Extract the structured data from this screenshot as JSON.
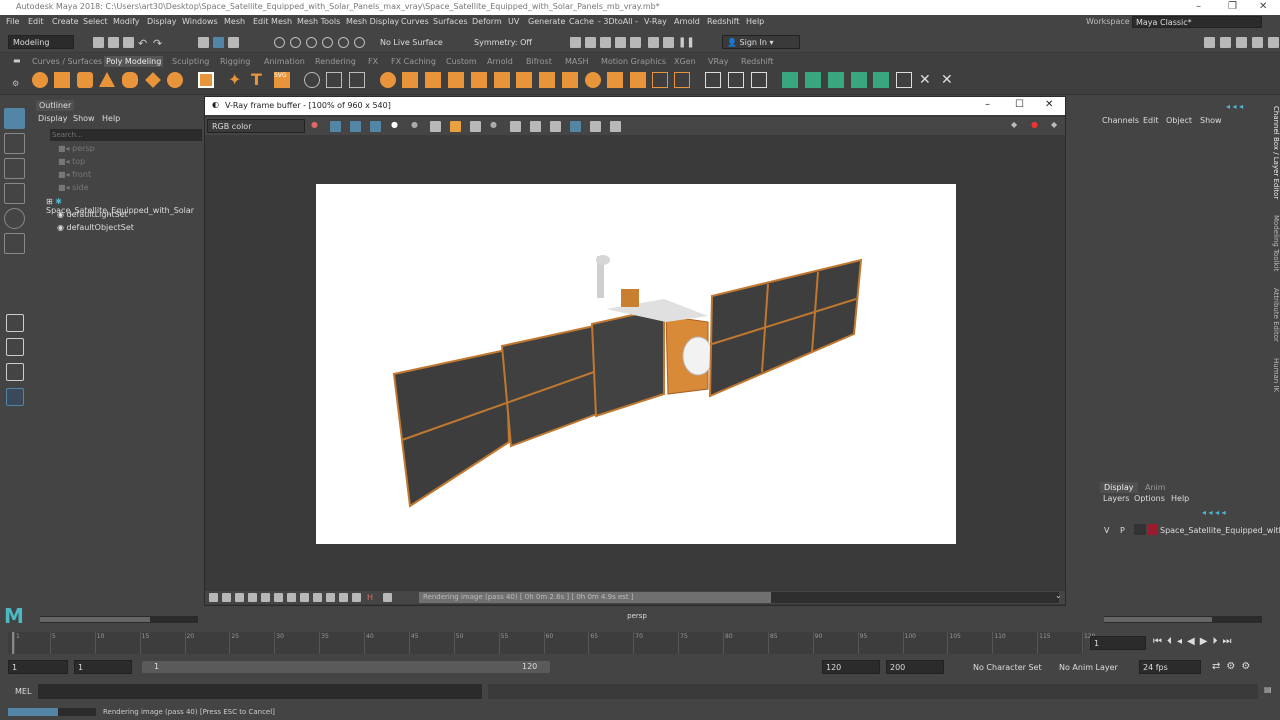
{
  "window": {
    "title": "Autodesk Maya 2018: C:\\Users\\art30\\Desktop\\Space_Satellite_Equipped_with_Solar_Panels_max_vray\\Space_Satellite_Equipped_with_Solar_Panels_mb_vray.mb*"
  },
  "menubar": {
    "items": [
      "File",
      "Edit",
      "Create",
      "Select",
      "Modify",
      "Display",
      "Windows",
      "Mesh",
      "Edit Mesh",
      "Mesh Tools",
      "Mesh Display",
      "Curves",
      "Surfaces",
      "Deform",
      "UV",
      "Generate",
      "Cache",
      "- 3DtoAll -",
      "V-Ray",
      "Arnold",
      "Redshift",
      "Help"
    ],
    "workspace_label": "Workspace :",
    "workspace_value": "Maya Classic*"
  },
  "statusline": {
    "mode": "Modeling",
    "live_surface": "No Live Surface",
    "symmetry": "Symmetry: Off",
    "sign_in": "Sign In"
  },
  "shelf": {
    "tabs": [
      "Curves / Surfaces",
      "Poly Modeling",
      "Sculpting",
      "Rigging",
      "Animation",
      "Rendering",
      "FX",
      "FX Caching",
      "Custom",
      "Arnold",
      "Bifrost",
      "MASH",
      "Motion Graphics",
      "XGen",
      "VRay",
      "Redshift"
    ],
    "active": "Poly Modeling"
  },
  "outliner": {
    "title": "Outliner",
    "menu": [
      "Display",
      "Show",
      "Help"
    ],
    "search_placeholder": "Search...",
    "items": [
      "persp",
      "top",
      "front",
      "side",
      "Space_Satellite_Equipped_with_Solar",
      "defaultLightSet",
      "defaultObjectSet"
    ]
  },
  "vray": {
    "title": "V-Ray frame buffer - [100% of 960 x 540]",
    "channel": "RGB color",
    "progress_text": "Rendering image (pass 40) [ 0h  0m  2.6s ] [ 0h  0m  4.9s est ]",
    "progress": 0.55
  },
  "viewport": {
    "camera": "persp"
  },
  "channelbox": {
    "menu": [
      "Channels",
      "Edit",
      "Object",
      "Show"
    ],
    "side_tabs": [
      "Channel Box / Layer Editor",
      "Modeling Toolkit",
      "Attribute Editor",
      "Human IK"
    ]
  },
  "layers": {
    "tabs": [
      "Display",
      "Anim"
    ],
    "menu": [
      "Layers",
      "Options",
      "Help"
    ],
    "row": {
      "v": "V",
      "p": "P",
      "name": "Space_Satellite_Equipped_with",
      "color": "#9b1a2e"
    }
  },
  "timeline": {
    "ticks": [
      "1",
      "5",
      "10",
      "15",
      "20",
      "25",
      "30",
      "35",
      "40",
      "45",
      "50",
      "55",
      "60",
      "65",
      "70",
      "75",
      "80",
      "85",
      "90",
      "95",
      "100",
      "105",
      "110",
      "115",
      "120"
    ],
    "current": "1"
  },
  "range": {
    "start": "1",
    "playstart": "1",
    "slider_start": "1",
    "slider_end": "120",
    "playend": "120",
    "end": "200",
    "character_set": "No Character Set",
    "anim_layer": "No Anim Layer",
    "fps": "24 fps"
  },
  "cmd": {
    "label": "MEL"
  },
  "help": {
    "text": "Rendering image (pass 40) [Press ESC to Cancel]"
  },
  "colors": {
    "accent": "#5285a6",
    "maya_orange": "#e8943a",
    "shelf_green": "#3aa680"
  }
}
